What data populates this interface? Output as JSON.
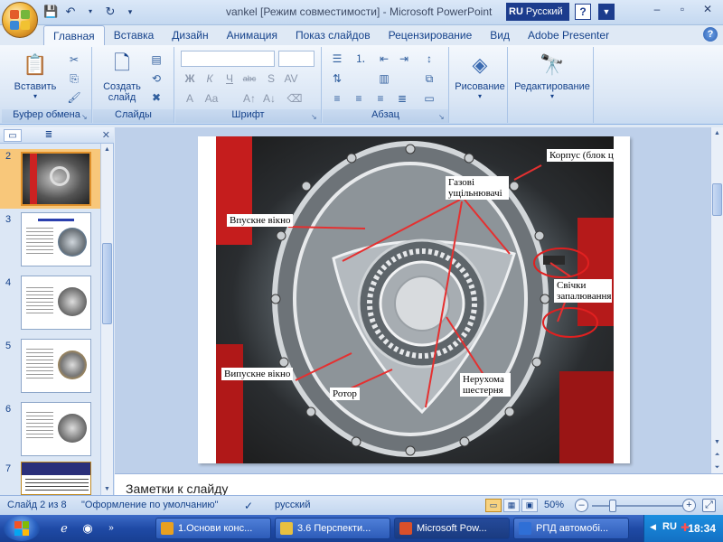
{
  "window": {
    "title": "vankel [Режим совместимости] - Microsoft PowerPoint",
    "lang_code": "RU",
    "lang_name": "Русский",
    "help": "?",
    "accent": "#1c3c8d"
  },
  "tabs": [
    "Главная",
    "Вставка",
    "Дизайн",
    "Анимация",
    "Показ слайдов",
    "Рецензирование",
    "Вид",
    "Adobe Presenter"
  ],
  "ribbon": {
    "clipboard": {
      "paste_label": "Вставить",
      "group_label": "Буфер обмена"
    },
    "slides": {
      "new_slide_label": "Создать слайд",
      "group_label": "Слайды"
    },
    "font": {
      "group_label": "Шрифт"
    },
    "paragraph": {
      "group_label": "Абзац"
    },
    "drawing": {
      "label": "Рисование"
    },
    "editing": {
      "label": "Редактирование"
    }
  },
  "slides_panel": {
    "thumbnails": [
      {
        "number": "2",
        "active": true
      },
      {
        "number": "3",
        "active": false
      },
      {
        "number": "4",
        "active": false
      },
      {
        "number": "5",
        "active": false
      },
      {
        "number": "6",
        "active": false
      },
      {
        "number": "7",
        "active": false
      }
    ]
  },
  "slide": {
    "labels": {
      "body": "Корпус (блок циліндрів)",
      "seals": "Газові ущільнювачі",
      "intake": "Впускне вікно",
      "plugs": "Свічки запалювання",
      "exhaust": "Випускне вікно",
      "rotor": "Ротор",
      "gear": "Нерухома шестерня"
    }
  },
  "notes": {
    "placeholder": "Заметки к слайду"
  },
  "status": {
    "slide_of": "Слайд 2 из 8",
    "theme": "\"Оформление по умолчанию\"",
    "language": "русский",
    "zoom": "50%"
  },
  "taskbar": {
    "tasks": [
      {
        "label": "1.Основи конс...",
        "color": "#e8a020"
      },
      {
        "label": "3.6 Перспекти...",
        "color": "#e8c040"
      },
      {
        "label": "Microsoft Pow...",
        "color": "#d9502a"
      },
      {
        "label": "РПД автомобі...",
        "color": "#2f6fd6"
      }
    ],
    "clock": "18:34",
    "tray_lang": "RU"
  }
}
